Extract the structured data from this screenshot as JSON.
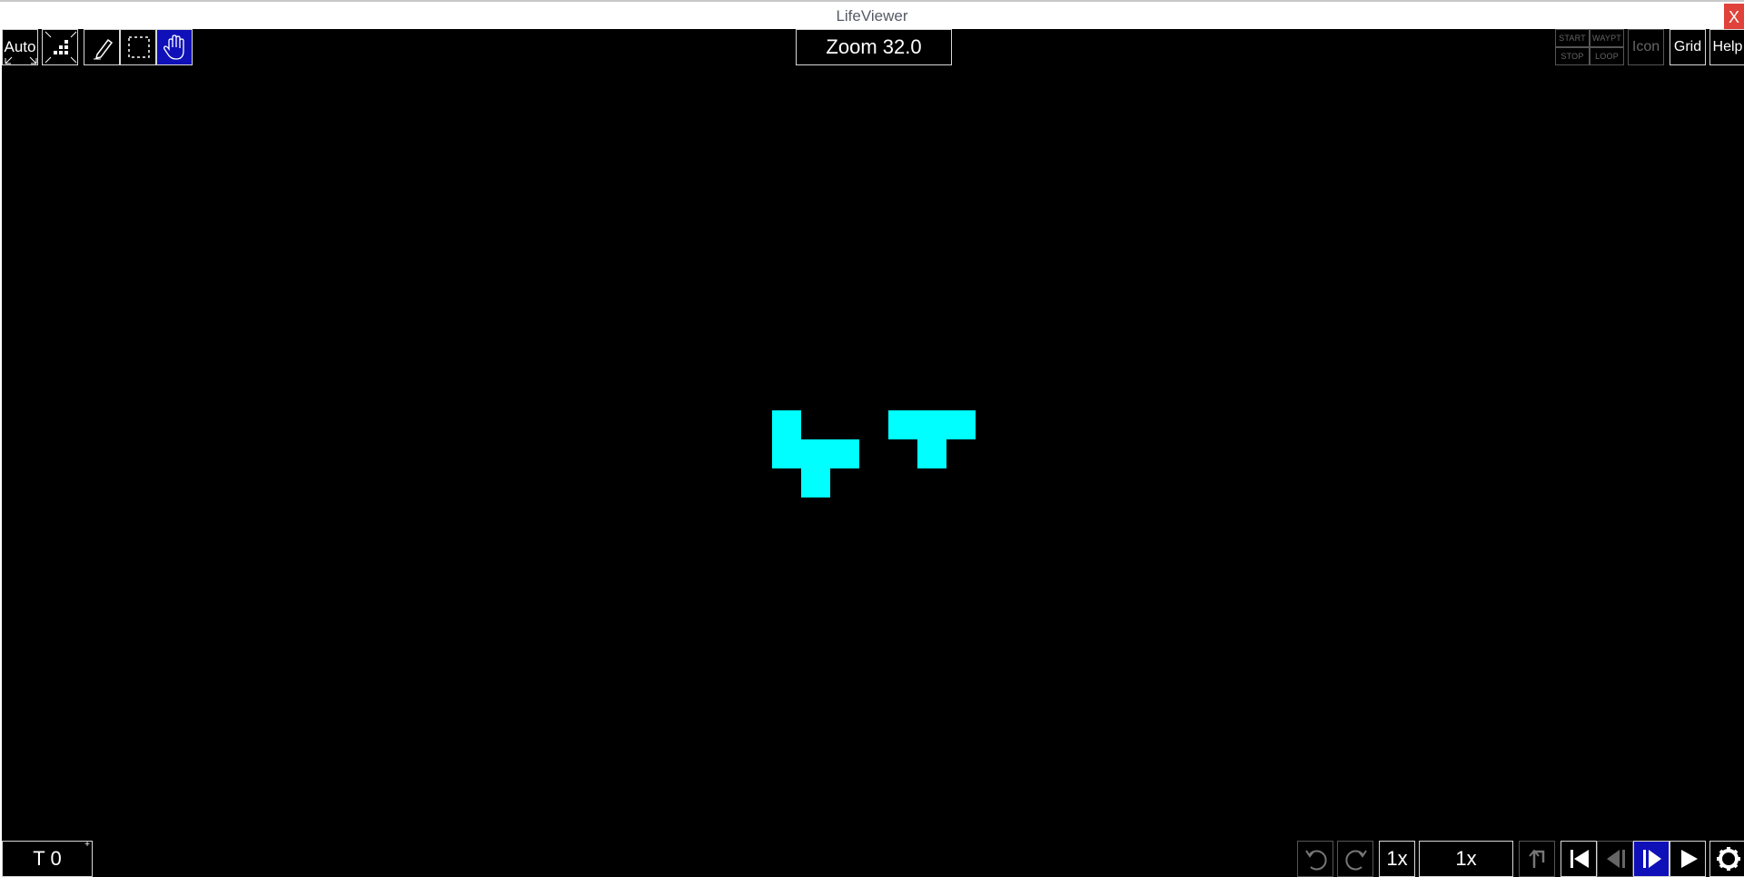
{
  "window": {
    "title": "LifeViewer",
    "close_label": "X"
  },
  "top_left_toolbar": {
    "auto_label": "Auto"
  },
  "zoom": {
    "label": "Zoom 32.0"
  },
  "top_right_toolbar": {
    "start_label": "START",
    "waypt_label": "WAYPT",
    "stop_label": "STOP",
    "loop_label": "LOOP",
    "icon_label": "Icon",
    "grid_label": "Grid",
    "help_label": "Help"
  },
  "bottom_left": {
    "generation_label": "T 0"
  },
  "bottom_right_toolbar": {
    "step_label": "1x",
    "speed_label": "1x"
  },
  "colors": {
    "background": "#000000",
    "cell": "#00ffff",
    "active_button": "#1010b8",
    "close_button": "#e0423a"
  },
  "icons": [
    "fit-zoom-icon",
    "population-icon",
    "pencil-icon",
    "select-icon",
    "pan-hand-icon",
    "undo-icon",
    "redo-icon",
    "reset-icon",
    "first-icon",
    "step-back-icon",
    "step-forward-icon",
    "play-icon",
    "settings-icon"
  ]
}
